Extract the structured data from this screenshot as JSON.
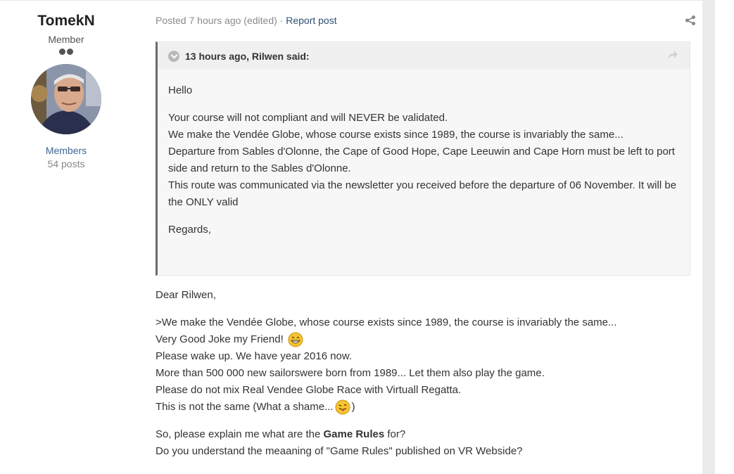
{
  "author": {
    "name": "TomekN",
    "title": "Member",
    "group": "Members",
    "posts": "54 posts"
  },
  "meta": {
    "posted": "Posted 7 hours ago (edited)",
    "separator": " · ",
    "report": "Report post"
  },
  "quote": {
    "citation": "13 hours ago, Rilwen said:",
    "paragraphs": {
      "p1": "Hello",
      "p2": {
        "l1": "Your course will not compliant and will NEVER be validated.",
        "l2": "We make the Vendée Globe, whose course exists since 1989, the course is invariably the same...",
        "l3": "Departure from Sables d'Olonne, the Cape of Good Hope, Cape Leeuwin and Cape Horn must be left to port side and return to the Sables d'Olonne.",
        "l4": "This route was communicated via the newsletter you received before the departure of 06 November. It will be the ONLY valid"
      },
      "p3": "Regards,"
    }
  },
  "reply": {
    "greeting": "Dear Rilwen,",
    "l1": ">We make the Vendée Globe, whose course exists since 1989, the course is invariably the same...",
    "l2": "Very Good Joke my Friend!",
    "l3": "Please wake up. We have year 2016 now.",
    "l4": "More than 500 000 new sailorswere born from 1989... Let them also play the game.",
    "l5": "Please do not mix Real Vendee Globe Race with Virtuall Regatta.",
    "l6_a": "This is not the same (What a shame...",
    "l6_b": ")",
    "l7_a": "So, please explain me what are the ",
    "l7_bold": "Game Rules",
    "l7_b": " for?",
    "l8": "Do you understand the meaaning of \"Game Rules\" published on VR Webside?"
  },
  "icons": {
    "share": "share-icon",
    "toggle": "chevron-down-icon",
    "jump": "share-arrow-icon",
    "emoji1": "grin-emoji-icon",
    "emoji2": "tongue-emoji-icon"
  },
  "colors": {
    "link": "#2d4f73",
    "group": "#3d6594",
    "quote_border": "#6b6b6b"
  }
}
